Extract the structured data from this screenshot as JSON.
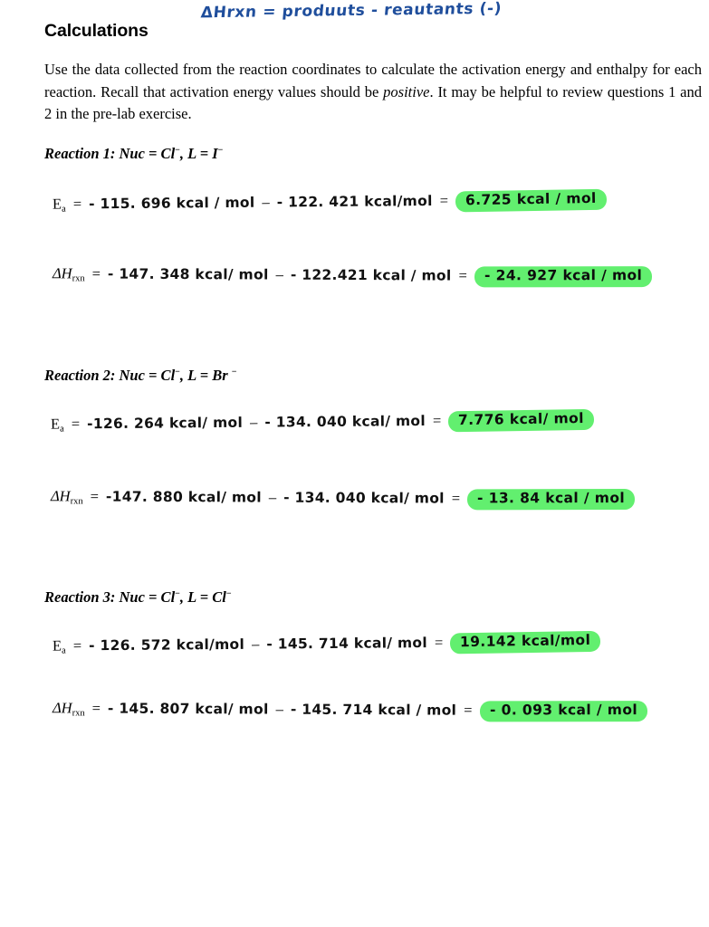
{
  "annotation": {
    "text": "ΔHrxn = produuts - reautants   (-)",
    "color": "#1f4e9c"
  },
  "highlight_color": "#62ef6f",
  "heading": "Calculations",
  "intro": {
    "part1": "Use the data collected from the reaction coordinates to calculate the activation energy and enthalpy for each reaction.  Recall that activation energy values should be ",
    "emphasis": "positive",
    "part2": ".  It may be helpful to review questions 1 and 2 in the pre-lab exercise."
  },
  "reactions": [
    {
      "heading_text": "Reaction 1: Nuc = Cl",
      "heading_charge1": "−",
      "heading_mid": ", L = I",
      "heading_charge2": "−",
      "ea": {
        "label": "E",
        "sub": "a",
        "eq": "=",
        "term1": "- 115. 696 kcal / mol",
        "operator": "–",
        "term2": "- 122. 421 kcal/mol",
        "eq2": "=",
        "result": "6.725 kcal / mol"
      },
      "dh": {
        "label": "ΔH",
        "sub": "rxn",
        "eq": "=",
        "term1": "- 147. 348 kcal/ mol",
        "operator": "–",
        "term2": "- 122.421 kcal / mol",
        "eq2": "=",
        "result": "- 24. 927 kcal / mol"
      }
    },
    {
      "heading_text": "Reaction 2: Nuc = Cl",
      "heading_charge1": "−",
      "heading_mid": ", L = Br ",
      "heading_charge2": "−",
      "ea": {
        "label": "E",
        "sub": "a",
        "eq": "=",
        "term1": "-126. 264 kcal/ mol",
        "operator": "–",
        "term2": "- 134. 040 kcal/ mol",
        "eq2": "=",
        "result": "7.776 kcal/ mol"
      },
      "dh": {
        "label": "ΔH",
        "sub": "rxn",
        "eq": "=",
        "term1": "-147. 880 kcal/ mol",
        "operator": "–",
        "term2": "- 134. 040 kcal/ mol",
        "eq2": "=",
        "result": "- 13. 84 kcal / mol"
      }
    },
    {
      "heading_text": "Reaction 3: Nuc = Cl",
      "heading_charge1": "−",
      "heading_mid": ", L = Cl",
      "heading_charge2": "−",
      "ea": {
        "label": "E",
        "sub": "a",
        "eq": "=",
        "term1": "- 126. 572 kcal/mol",
        "operator": "–",
        "term2": "- 145. 714 kcal/ mol",
        "eq2": "=",
        "result": "19.142 kcal/mol"
      },
      "dh": {
        "label": "ΔH",
        "sub": "rxn",
        "eq": "=",
        "term1": "- 145. 807 kcal/ mol",
        "operator": "–",
        "term2": "- 145. 714 kcal / mol",
        "eq2": "=",
        "result": "- 0. 093 kcal / mol"
      }
    }
  ]
}
